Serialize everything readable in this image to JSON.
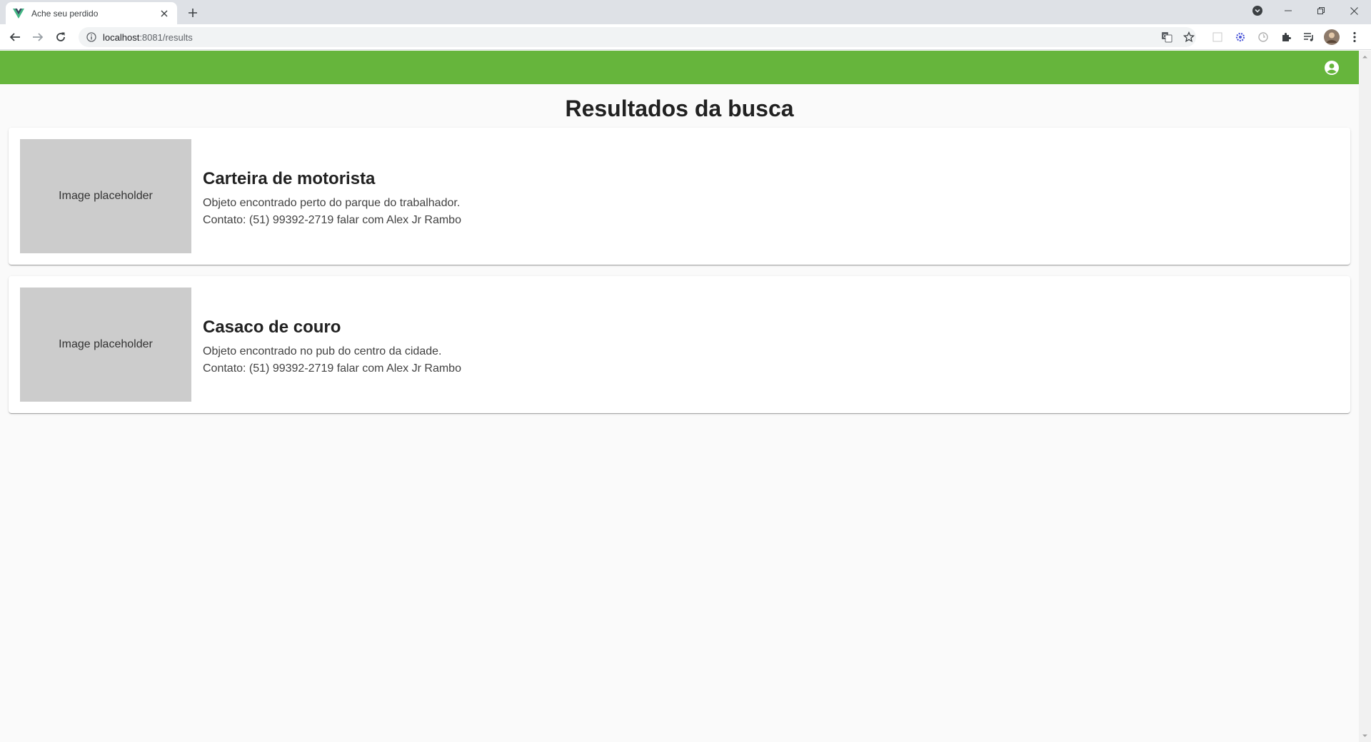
{
  "browser": {
    "tab_title": "Ache seu perdido",
    "url_host": "localhost",
    "url_rest": ":8081/results"
  },
  "colors": {
    "accent_green": "#66b53c",
    "vue_green": "#41b883",
    "vue_dark": "#35495e"
  },
  "icons": {
    "back": "arrow-left-icon",
    "forward": "arrow-right-icon",
    "reload": "reload-icon",
    "info": "info-icon",
    "translate": "translate-icon",
    "bookmark": "star-icon",
    "extensions": "puzzle-icon",
    "account": "account-circle-icon"
  },
  "page": {
    "title": "Resultados da busca"
  },
  "results": [
    {
      "image_label": "Image placeholder",
      "title": "Carteira de motorista",
      "description": "Objeto encontrado perto do parque do trabalhador.",
      "contact": "Contato: (51) 99392-2719 falar com Alex Jr Rambo"
    },
    {
      "image_label": "Image placeholder",
      "title": "Casaco de couro",
      "description": "Objeto encontrado no pub do centro da cidade.",
      "contact": "Contato: (51) 99392-2719 falar com Alex Jr Rambo"
    }
  ]
}
